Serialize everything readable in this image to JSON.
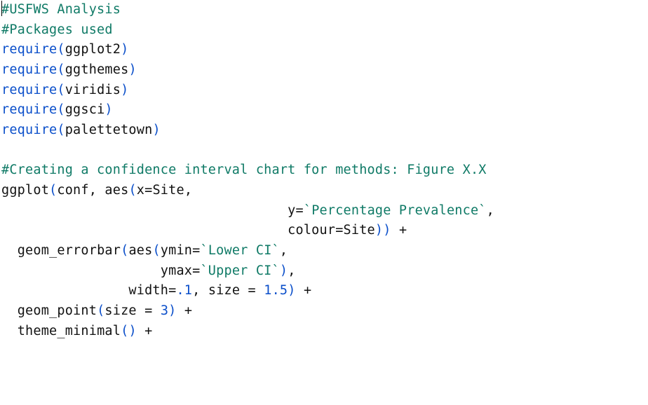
{
  "code": {
    "l01_comment": "#USFWS Analysis",
    "l02_comment": "#Packages used",
    "require_kw": "require",
    "pkg": {
      "a": "ggplot2",
      "b": "ggthemes",
      "c": "viridis",
      "d": "ggsci",
      "e": "palettetown"
    },
    "l09_comment": "#Creating a confidence interval chart for methods: Figure X.X",
    "fn": {
      "ggplot": "ggplot",
      "aes": "aes",
      "geom_errorbar": "geom_errorbar",
      "geom_point": "geom_point",
      "theme_minimal": "theme_minimal"
    },
    "arg": {
      "conf": "conf",
      "x": "x",
      "Site": "Site",
      "y": "y",
      "colour": "colour",
      "ymin": "ymin",
      "ymax": "ymax",
      "width": "width",
      "size": "size"
    },
    "str": {
      "pp": "`Percentage Prevalence`",
      "lci": "`Lower CI`",
      "uci": "`Upper CI`"
    },
    "num": {
      "w": ".1",
      "s15": "1.5",
      "s3": "3"
    },
    "paren": {
      "open": "(",
      "close": ")"
    },
    "comma": ", ",
    "eq": "=",
    "plus": "+"
  }
}
